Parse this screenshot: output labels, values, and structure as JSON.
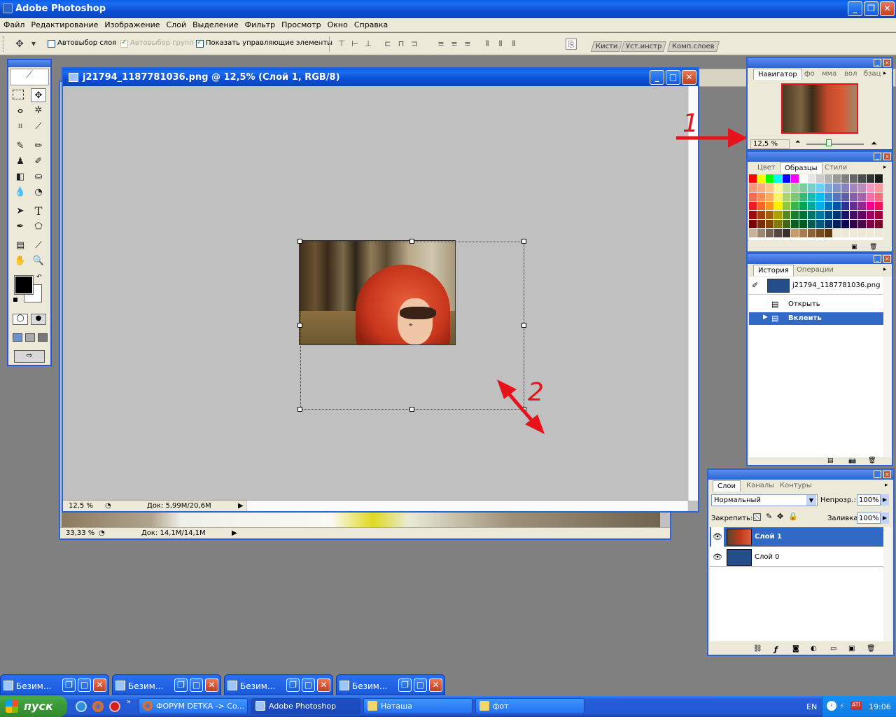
{
  "app": {
    "title": "Adobe Photoshop"
  },
  "menu": [
    "Файл",
    "Редактирование",
    "Изображение",
    "Слой",
    "Выделение",
    "Фильтр",
    "Просмотр",
    "Окно",
    "Справка"
  ],
  "options": {
    "auto_select_layer": "Автовыбор слоя",
    "auto_select_group": "Автовыбор групп",
    "show_transform": "Показать управляющие элементы"
  },
  "well_tabs": [
    "Кисти",
    "Уст.инстр",
    "Комп.слоев"
  ],
  "doc_front": {
    "title": "j21794_1187781036.png @ 12,5% (Слой 1, RGB/8)",
    "zoom": "12,5 %",
    "doc_size": "Док: 5,99M/20,6M"
  },
  "doc_back": {
    "zoom": "33,33 %",
    "doc_size": "Док: 14,1M/14,1M"
  },
  "navigator": {
    "tabs": [
      "Навигатор",
      "Информация",
      "Гистограмма"
    ],
    "tab_labels": [
      "Навигатор",
      "фо",
      "мма",
      "вол",
      "бзац"
    ],
    "zoom": "12,5 %"
  },
  "swatches": {
    "tabs": [
      "Цвет",
      "Образцы",
      "Стили"
    ]
  },
  "history": {
    "tabs": [
      "История",
      "Операции"
    ],
    "snapshot": "j21794_1187781036.png",
    "items": [
      "Открыть",
      "Вклеить"
    ]
  },
  "layers": {
    "tabs": [
      "Слои",
      "Каналы",
      "Контуры"
    ],
    "blend_mode": "Нормальный",
    "opacity_label": "Непрозр.:",
    "opacity": "100%",
    "lock_label": "Закрепить:",
    "fill_label": "Заливка:",
    "fill": "100%",
    "items": [
      "Слой 1",
      "Слой 0"
    ]
  },
  "annotations": {
    "marker1": "1",
    "marker2": "2"
  },
  "minimized": [
    "Безим...",
    "Безим...",
    "Безим...",
    "Безим..."
  ],
  "taskbar": {
    "start": "пуск",
    "tasks": [
      "ФОРУМ DETKA -> Co...",
      "Adobe Photoshop",
      "Наташа",
      "фот"
    ],
    "lang": "EN",
    "clock": "19:06"
  }
}
